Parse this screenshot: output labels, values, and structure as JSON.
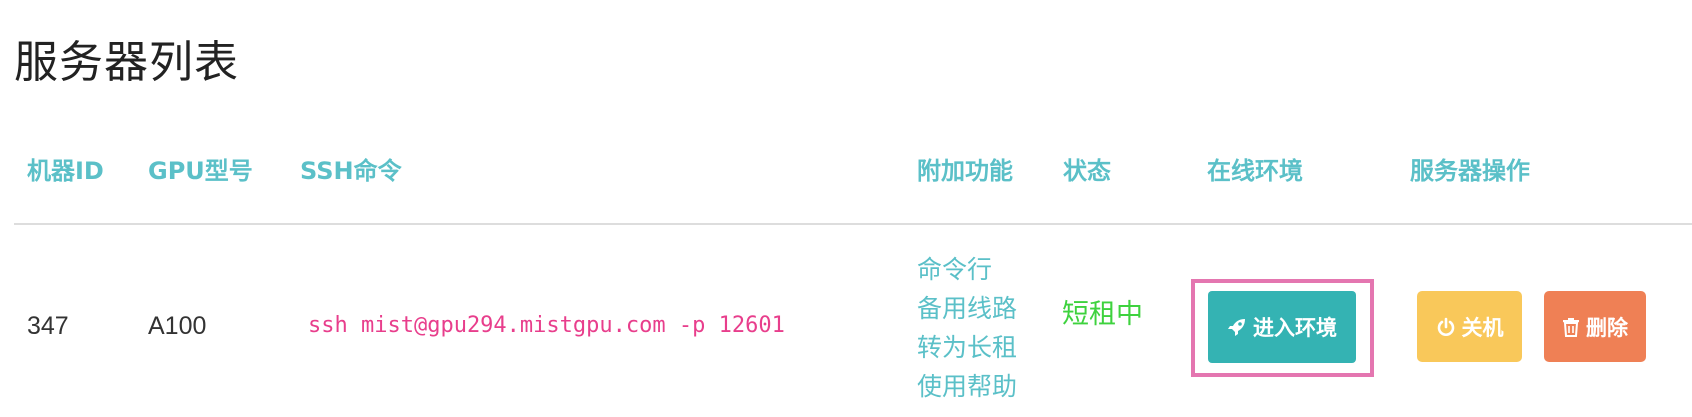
{
  "page": {
    "title": "服务器列表"
  },
  "table": {
    "headers": {
      "id": "机器ID",
      "gpu": "GPU型号",
      "ssh": "SSH命令",
      "extra": "附加功能",
      "status": "状态",
      "env": "在线环境",
      "ops": "服务器操作"
    },
    "rows": [
      {
        "id": "347",
        "gpu": "A100",
        "ssh": "ssh mist@gpu294.mistgpu.com -p 12601",
        "extra": [
          "命令行",
          "备用线路",
          "转为长租",
          "使用帮助"
        ],
        "status": "短租中",
        "env_button": {
          "label": "进入环境",
          "icon": "rocket-icon"
        },
        "shutdown_button": {
          "label": "关机",
          "icon": "power-icon"
        },
        "delete_button": {
          "label": "删除",
          "icon": "trash-icon"
        }
      }
    ]
  },
  "colors": {
    "header_text": "#5bc0c8",
    "ssh_text": "#e83e8c",
    "status_text": "#3ed23e",
    "env_button": "#34b3b3",
    "env_highlight_border": "#e476b0",
    "shutdown_button": "#f9c85a",
    "delete_button": "#ef8055"
  }
}
